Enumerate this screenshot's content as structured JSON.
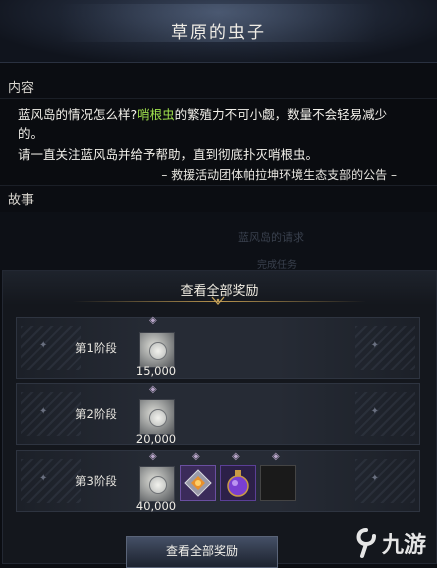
{
  "header": {
    "title": "草原的虫子"
  },
  "content": {
    "label": "内容",
    "line1_a": "蓝风岛的情况怎么样?",
    "line1_highlight": "哨根虫",
    "line1_b": "的繁殖力不可小觑，数量不会轻易减少",
    "line2": "的。",
    "line3": "请一直关注蓝风岛并给予帮助，直到彻底扑灭哨根虫。",
    "signature": "– 救援活动团体帕拉坤环境生态支部的公告 –"
  },
  "story": {
    "label": "故事",
    "ghost1": "蓝风岛的请求",
    "ghost2": "完成任务"
  },
  "rewards": {
    "title": "查看全部奖励",
    "stages": [
      {
        "label": "第1阶段",
        "count": "15,000"
      },
      {
        "label": "第2阶段",
        "count": "20,000"
      },
      {
        "label": "第3阶段",
        "count": "40,000"
      }
    ],
    "footer_button": "查看全部奖励"
  },
  "watermark": {
    "text": "九游"
  },
  "colors": {
    "highlight": "#9fe04d",
    "gold": "#c7a35a"
  }
}
